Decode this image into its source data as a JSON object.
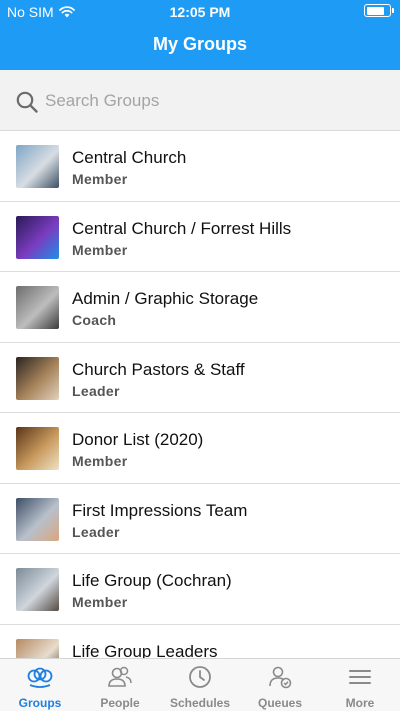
{
  "status": {
    "carrier": "No SIM",
    "time": "12:05 PM",
    "battery_level": 0.85
  },
  "header": {
    "title": "My Groups"
  },
  "search": {
    "placeholder": "Search Groups",
    "value": ""
  },
  "groups": [
    {
      "name": "Central Church",
      "role": "Member",
      "thumb": [
        "#7fa5c8",
        "#d8dde2",
        "#3c4f63"
      ]
    },
    {
      "name": "Central Church / Forrest Hills",
      "role": "Member",
      "thumb": [
        "#2a1a55",
        "#7a3cc0",
        "#1e8fe8"
      ]
    },
    {
      "name": "Admin / Graphic Storage",
      "role": "Coach",
      "thumb": [
        "#6d6d6d",
        "#bdbdbd",
        "#3a3a3a"
      ]
    },
    {
      "name": "Church Pastors & Staff",
      "role": "Leader",
      "thumb": [
        "#2b2520",
        "#a8845c",
        "#e2d2bc"
      ]
    },
    {
      "name": "Donor List (2020)",
      "role": "Member",
      "thumb": [
        "#5a3418",
        "#c89a5e",
        "#efe2c2"
      ]
    },
    {
      "name": "First Impressions Team",
      "role": "Leader",
      "thumb": [
        "#3d4e66",
        "#b7c0cb",
        "#d9a67e"
      ]
    },
    {
      "name": "Life Group (Cochran)",
      "role": "Member",
      "thumb": [
        "#7c8a96",
        "#cfd6dc",
        "#544a40"
      ]
    },
    {
      "name": "Life Group Leaders",
      "role": "",
      "thumb": [
        "#b48a62",
        "#e8dccd",
        "#3a2f26"
      ]
    }
  ],
  "tabs": [
    {
      "label": "Groups",
      "icon": "groups-icon",
      "active": true
    },
    {
      "label": "People",
      "icon": "people-icon",
      "active": false
    },
    {
      "label": "Schedules",
      "icon": "clock-icon",
      "active": false
    },
    {
      "label": "Queues",
      "icon": "queue-person-icon",
      "active": false
    },
    {
      "label": "More",
      "icon": "menu-icon",
      "active": false
    }
  ],
  "colors": {
    "accent": "#1e9bf5",
    "tab_active": "#1e7fe0",
    "tab_inactive": "#8a8a8a"
  }
}
